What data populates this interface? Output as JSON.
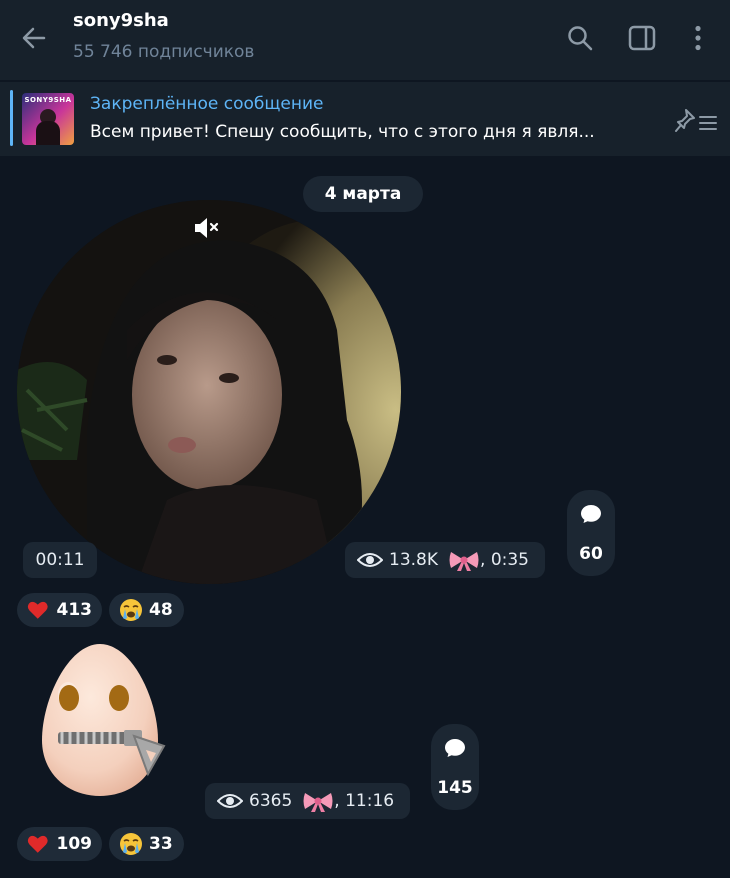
{
  "header": {
    "title": "sony9sha",
    "subtitle": "55 746 подписчиков"
  },
  "pinned": {
    "title": "Закреплённое сообщение",
    "text": "Всем привет!  Спешу сообщить, что с этого дня я явля...",
    "thumb_text": "SONY9SHA"
  },
  "date_chip": "4 марта",
  "messages": [
    {
      "type": "video-note",
      "duration": "00:11",
      "views": "13.8K",
      "time": "0:35",
      "comments": "60",
      "reactions": [
        {
          "icon": "heart-icon",
          "count": "413"
        },
        {
          "icon": "crying-face-icon",
          "count": "48"
        }
      ]
    },
    {
      "type": "sticker",
      "views": "6365",
      "time": "11:16",
      "comments": "145",
      "reactions": [
        {
          "icon": "heart-icon",
          "count": "109"
        },
        {
          "icon": "crying-face-icon",
          "count": "33"
        }
      ]
    }
  ],
  "colors": {
    "background": "#0e1621",
    "header": "#17212b",
    "accent": "#5eb5f7",
    "chip": "#1c2733",
    "heart": "#e02a2a"
  }
}
